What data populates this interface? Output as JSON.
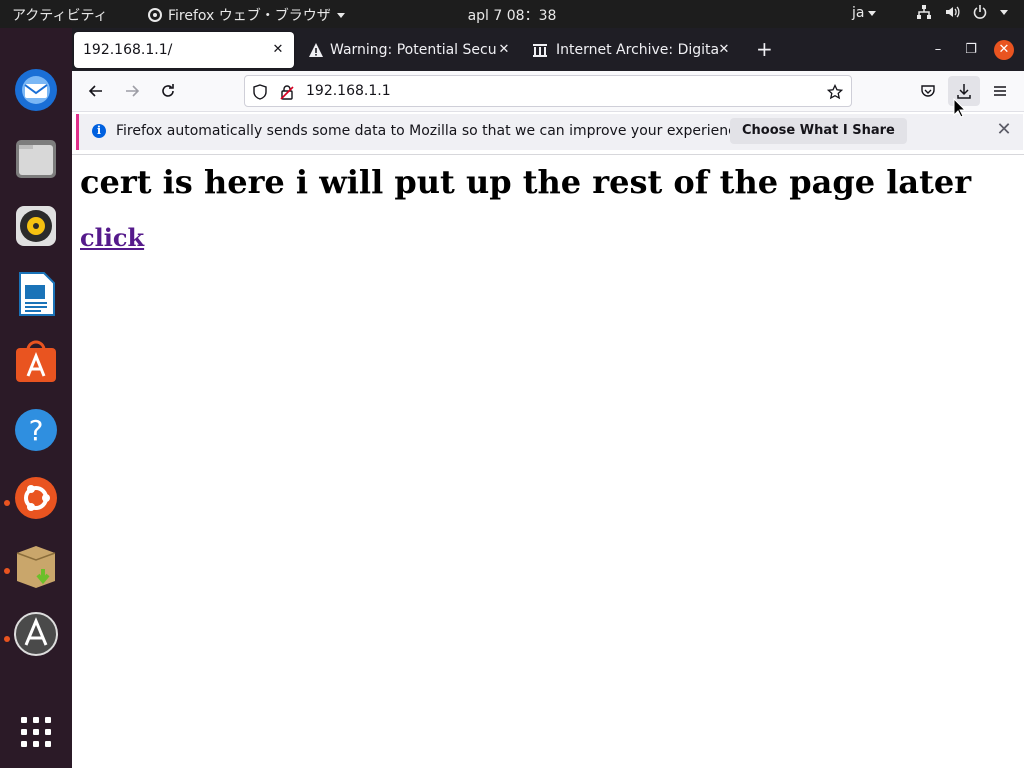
{
  "topbar": {
    "activities": "アクティビティ",
    "app_name": "Firefox ウェブ・ブラウザ",
    "clock": "apl 7  08：38",
    "input_method": "ja"
  },
  "dock": {
    "items": [
      {
        "name": "thunderbird-icon"
      },
      {
        "name": "files-icon"
      },
      {
        "name": "rhythmbox-icon"
      },
      {
        "name": "libreoffice-writer-icon"
      },
      {
        "name": "software-center-icon"
      },
      {
        "name": "help-icon"
      },
      {
        "name": "ubuntu-icon"
      },
      {
        "name": "archive-install-icon"
      },
      {
        "name": "software-updater-icon"
      }
    ]
  },
  "browser": {
    "tabs": [
      {
        "title": "192.168.1.1/",
        "active": true
      },
      {
        "title": "Warning: Potential Securi",
        "icon": "warning-icon",
        "active": false
      },
      {
        "title": "Internet Archive: Digital L",
        "icon": "archive-icon",
        "active": false
      }
    ],
    "url": "192.168.1.1",
    "infobar": {
      "message": "Firefox automatically sends some data to Mozilla so that we can improve your experience.",
      "button": "Choose What I Share"
    }
  },
  "page": {
    "heading": "cert is here i will put up the rest of the page later",
    "link": "click"
  },
  "colors": {
    "ubuntu_orange": "#e95420",
    "link_visited": "#551a8b",
    "topbar_bg": "#1d1d1d",
    "tabstrip_bg": "#1f1e25"
  }
}
